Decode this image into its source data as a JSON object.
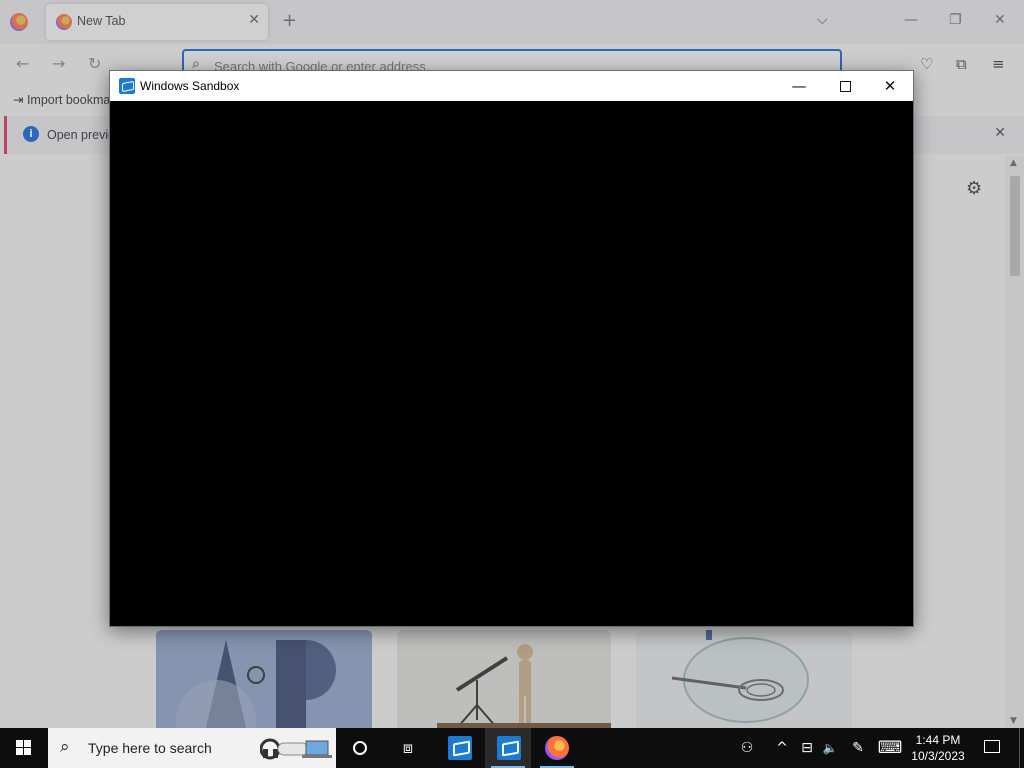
{
  "browser": {
    "tab": {
      "title": "New Tab",
      "close_glyph": "✕"
    },
    "new_tab_glyph": "+",
    "list_tabs_glyph": "⌵",
    "window_controls": {
      "minimize": "—",
      "restore": "❐",
      "close": "✕"
    },
    "nav": {
      "back": "←",
      "forward": "→",
      "reload": "↻"
    },
    "urlbar": {
      "placeholder": "Search with Google or enter address",
      "value": ""
    },
    "toolbar_icons": [
      "pocket-icon",
      "extensions-icon",
      "menu-icon"
    ],
    "bookmark_item": "Import bookmarks…",
    "notice": {
      "text": "Open previous tabs?",
      "close_glyph": "✕"
    },
    "accent_color": "#0061e0"
  },
  "sandbox": {
    "title": "Windows Sandbox",
    "controls": {
      "minimize": "—",
      "maximize": "",
      "close": "✕"
    }
  },
  "taskbar": {
    "search_placeholder": "Type here to search",
    "apps": [
      "Windows Sandbox",
      "Windows Sandbox",
      "Firefox"
    ],
    "tray": {
      "people": "⚇",
      "chevron": "^",
      "network": "⊟",
      "volume": "🔈",
      "pen": "✎",
      "keyboard": "⌨"
    },
    "clock": {
      "time": "1:44 PM",
      "date": "10/3/2023"
    }
  }
}
